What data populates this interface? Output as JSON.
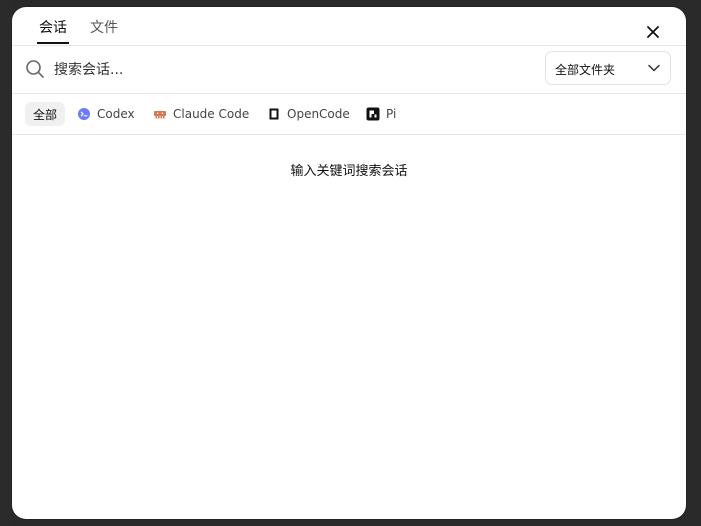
{
  "tabs": [
    {
      "label": "会话",
      "active": true
    },
    {
      "label": "文件",
      "active": false
    }
  ],
  "search": {
    "placeholder": "搜索会话...",
    "value": ""
  },
  "folder_select": {
    "selected": "全部文件夹"
  },
  "filters": [
    {
      "label": "全部",
      "icon": "",
      "active": true
    },
    {
      "label": "Codex",
      "icon": "codex-icon",
      "active": false
    },
    {
      "label": "Claude Code",
      "icon": "claude-code-icon",
      "active": false
    },
    {
      "label": "OpenCode",
      "icon": "opencode-icon",
      "active": false
    },
    {
      "label": "Pi",
      "icon": "pi-icon",
      "active": false
    }
  ],
  "empty_state": {
    "message": "输入关键词搜索会话"
  },
  "colors": {
    "accent": "#111111",
    "codex": "#6b7cf6",
    "claude": "#d9774f",
    "border": "#e6e6e6"
  }
}
